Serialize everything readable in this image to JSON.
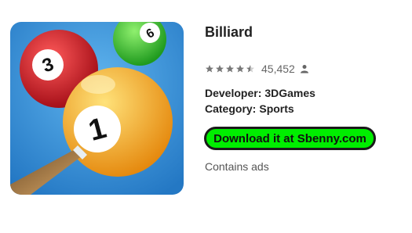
{
  "app": {
    "title": "Billiard",
    "rating_count": "45,452",
    "stars": 4.5,
    "developer_label": "Developer:",
    "developer": "3DGames",
    "category_label": "Category:",
    "category": "Sports",
    "download_label": "Download it at Sbenny.com",
    "ads_notice": "Contains ads"
  },
  "icon": {
    "ball_numbers": [
      "3",
      "6",
      "1"
    ],
    "colors": {
      "background": "#2f8ed6",
      "ball_red": "#d41f2a",
      "ball_green": "#3cc42c",
      "ball_yellow": "#f7a81f",
      "cue": "#b88446"
    }
  },
  "colors": {
    "download_bg": "#00ee00",
    "star": "#777777"
  }
}
